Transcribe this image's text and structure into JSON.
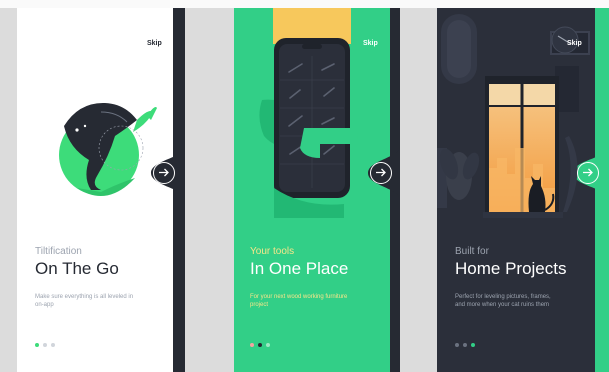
{
  "screens": [
    {
      "skip": "Skip",
      "subtitle": "Tiltification",
      "title": "On The Go",
      "description": "Make sure everything is all leveled in on-app",
      "colors": {
        "background": "#ffffff",
        "accent": "#3ddc7a",
        "strip": "#262a33"
      },
      "pagination_active": 1
    },
    {
      "skip": "Skip",
      "subtitle": "Your tools",
      "title": "In One Place",
      "description": "For your next wood working furniture project",
      "colors": {
        "background": "#32cf87",
        "accent": "#f7c85c",
        "strip": "#262a33"
      },
      "pagination_active": 2
    },
    {
      "skip": "Skip",
      "subtitle": "Built for",
      "title": "Home Projects",
      "description": "Perfect for leveling pictures, frames, and more when your cat ruins them",
      "colors": {
        "background": "#2b2f3a",
        "accent": "#f7a646",
        "strip": "#32cf87"
      },
      "pagination_active": 3
    }
  ],
  "icons": [
    "arrow-right-icon",
    "level-gauge-icon",
    "phone-tools-icon",
    "window-cat-icon"
  ]
}
